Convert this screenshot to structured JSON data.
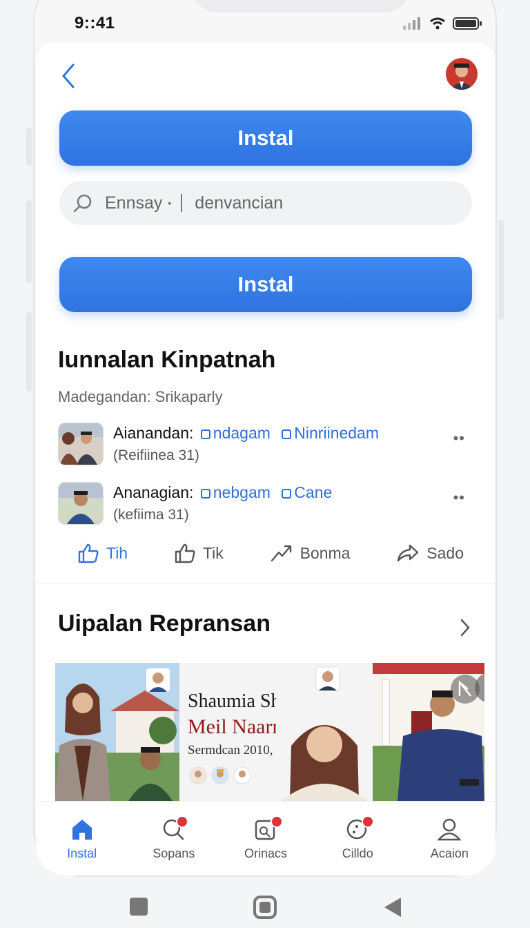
{
  "status": {
    "time": "9::41"
  },
  "actions_primary": {
    "install_label_top": "Instal",
    "install_label_bottom": "Instal"
  },
  "search": {
    "term": "Ennsay",
    "dot": "•",
    "value": "denvancian"
  },
  "section1": {
    "title": "Iunnalan Kinpatnah",
    "subtitle": "Madegandan: Srikaparly",
    "items": [
      {
        "name": "Aianandan:",
        "tag1": "ndagam",
        "tag2": "Ninriinedam",
        "meta": "(Reifiinea 31)"
      },
      {
        "name": "Ananagian:",
        "tag1": "nebgam",
        "tag2": "Cane",
        "meta": "(kefiima 31)"
      }
    ],
    "actions": [
      {
        "label": "Tih",
        "icon": "thumbs-up-icon"
      },
      {
        "label": "Tik",
        "icon": "thumbs-up-outline-icon"
      },
      {
        "label": "Bonma",
        "icon": "share-arrow-icon"
      },
      {
        "label": "Sado",
        "icon": "reply-icon"
      }
    ],
    "more": "••"
  },
  "section2": {
    "title": "Uipalan Repransan",
    "banner": {
      "line1": "Shaumia Shri",
      "line2": "Meil Naarn",
      "date": "Sermdcan 2010,"
    }
  },
  "tabs": [
    {
      "label": "Instal",
      "icon": "home-icon",
      "active": true
    },
    {
      "label": "Sopans",
      "icon": "search-icon",
      "badge": true
    },
    {
      "label": "Orinacs",
      "icon": "calendar-icon",
      "badge": true
    },
    {
      "label": "Cilldo",
      "icon": "chat-icon",
      "badge": true
    },
    {
      "label": "Acaion",
      "icon": "profile-icon"
    }
  ],
  "colors": {
    "accent": "#2f73e0",
    "badge": "#e0303a",
    "banner_red": "#8e1b1b"
  }
}
